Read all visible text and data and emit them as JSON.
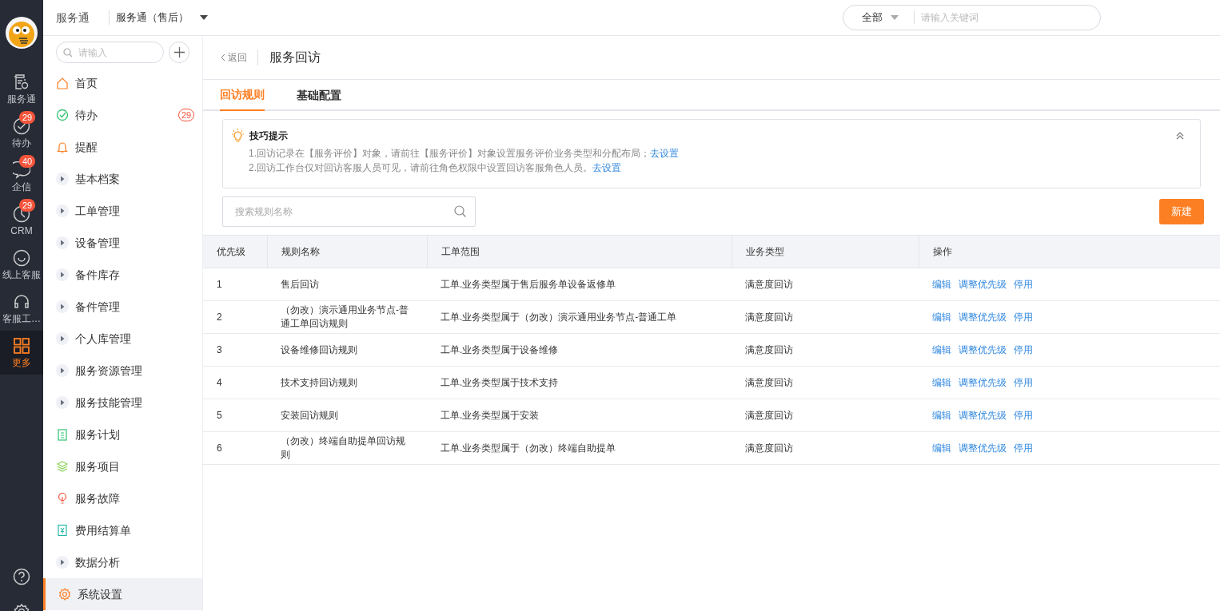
{
  "rail": {
    "items": [
      {
        "label": "服务通",
        "selected": false
      },
      {
        "label": "待办",
        "badge": "29",
        "selected": false
      },
      {
        "label": "企信",
        "badge": "40",
        "selected": false
      },
      {
        "label": "CRM",
        "badge": "29",
        "selected": false
      },
      {
        "label": "线上客服",
        "selected": false
      },
      {
        "label": "客服工…",
        "selected": false
      },
      {
        "label": "更多",
        "selected": true
      }
    ]
  },
  "topbar": {
    "app": "服务通",
    "switcher": "服务通（售后）",
    "search_scope": "全部",
    "search_placeholder": "请输入关键词"
  },
  "sidebar": {
    "search_placeholder": "请输入",
    "items": [
      {
        "kind": "page",
        "label": "首页",
        "selected": false
      },
      {
        "kind": "page",
        "label": "待办",
        "badge": "29",
        "selected": false
      },
      {
        "kind": "page",
        "label": "提醒",
        "selected": false
      },
      {
        "kind": "group",
        "label": "基本档案",
        "selected": false
      },
      {
        "kind": "group",
        "label": "工单管理",
        "selected": false
      },
      {
        "kind": "group",
        "label": "设备管理",
        "selected": false
      },
      {
        "kind": "group",
        "label": "备件库存",
        "selected": false
      },
      {
        "kind": "group",
        "label": "备件管理",
        "selected": false
      },
      {
        "kind": "group",
        "label": "个人库管理",
        "selected": false
      },
      {
        "kind": "group",
        "label": "服务资源管理",
        "selected": false
      },
      {
        "kind": "group",
        "label": "服务技能管理",
        "selected": false
      },
      {
        "kind": "page",
        "label": "服务计划",
        "selected": false
      },
      {
        "kind": "page",
        "label": "服务项目",
        "selected": false
      },
      {
        "kind": "page",
        "label": "服务故障",
        "selected": false
      },
      {
        "kind": "page",
        "label": "费用结算单",
        "selected": false
      },
      {
        "kind": "group",
        "label": "数据分析",
        "selected": false
      },
      {
        "kind": "page",
        "label": "系统设置",
        "selected": true
      }
    ]
  },
  "header": {
    "back": "返回",
    "title": "服务回访"
  },
  "tabs": [
    {
      "label": "回访规则",
      "selected": true
    },
    {
      "label": "基础配置",
      "selected": false
    }
  ],
  "tips": {
    "title": "技巧提示",
    "lines": [
      {
        "text": "1.回访记录在【服务评价】对象，请前往【服务评价】对象设置服务评价业务类型和分配布局；",
        "link": "去设置"
      },
      {
        "text": "2.回访工作台仅对回访客服人员可见，请前往角色权限中设置回访客服角色人员。",
        "link": "去设置"
      }
    ]
  },
  "search": {
    "placeholder": "搜索规则名称"
  },
  "new_button": "新建",
  "table": {
    "columns": [
      "优先级",
      "规则名称",
      "工单范围",
      "业务类型",
      "操作"
    ],
    "rows": [
      {
        "priority": "1",
        "name": "售后回访",
        "scope": "工单.业务类型属于售后服务单设备返修单",
        "type": "满意度回访",
        "actions": [
          "编辑",
          "调整优先级",
          "停用"
        ]
      },
      {
        "priority": "2",
        "name": "（勿改）演示通用业务节点-普通工单回访规则",
        "scope": "工单.业务类型属于（勿改）演示通用业务节点-普通工单",
        "type": "满意度回访",
        "actions": [
          "编辑",
          "调整优先级",
          "停用"
        ]
      },
      {
        "priority": "3",
        "name": "设备维修回访规则",
        "scope": "工单.业务类型属于设备维修",
        "type": "满意度回访",
        "actions": [
          "编辑",
          "调整优先级",
          "停用"
        ]
      },
      {
        "priority": "4",
        "name": "技术支持回访规则",
        "scope": "工单.业务类型属于技术支持",
        "type": "满意度回访",
        "actions": [
          "编辑",
          "调整优先级",
          "停用"
        ]
      },
      {
        "priority": "5",
        "name": "安装回访规则",
        "scope": "工单.业务类型属于安装",
        "type": "满意度回访",
        "actions": [
          "编辑",
          "调整优先级",
          "停用"
        ]
      },
      {
        "priority": "6",
        "name": "（勿改）终端自助提单回访规则",
        "scope": "工单.业务类型属于（勿改）终端自助提单",
        "type": "满意度回访",
        "actions": [
          "编辑",
          "调整优先级",
          "停用"
        ]
      }
    ]
  }
}
